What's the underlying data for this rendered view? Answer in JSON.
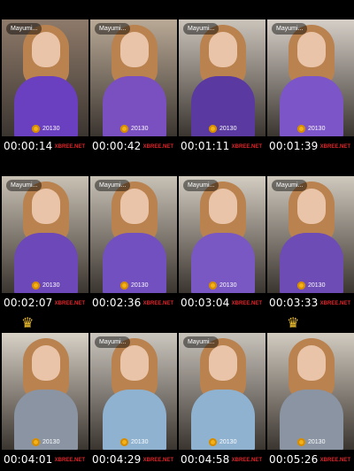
{
  "contact_sheet": {
    "watermark": "XBREE.NET",
    "thumbnails": [
      {
        "username": "Mayumi...",
        "coins": "20130",
        "timestamp": "00:00:14",
        "crown": false,
        "wall": "#8e7a6a",
        "outfit": "#6a3fc0"
      },
      {
        "username": "Mayumi...",
        "coins": "20130",
        "timestamp": "00:00:42",
        "crown": false,
        "wall": "#b9a996",
        "outfit": "#7a4fc0"
      },
      {
        "username": "Mayumi...",
        "coins": "20130",
        "timestamp": "00:01:11",
        "crown": false,
        "wall": "#cbc4bb",
        "outfit": "#5a3aa0"
      },
      {
        "username": "Mayumi...",
        "coins": "20130",
        "timestamp": "00:01:39",
        "crown": false,
        "wall": "#d6cfc8",
        "outfit": "#7c55c8"
      },
      {
        "username": "Mayumi...",
        "coins": "20130",
        "timestamp": "00:02:07",
        "crown": false,
        "wall": "#c9c1b4",
        "outfit": "#6c48b8"
      },
      {
        "username": "Mayumi...",
        "coins": "20130",
        "timestamp": "00:02:36",
        "crown": false,
        "wall": "#c8c1b6",
        "outfit": "#7250c0"
      },
      {
        "username": "Mayumi...",
        "coins": "20130",
        "timestamp": "00:03:04",
        "crown": false,
        "wall": "#d3ccc1",
        "outfit": "#7a58c4"
      },
      {
        "username": "Mayumi...",
        "coins": "20130",
        "timestamp": "00:03:33",
        "crown": false,
        "wall": "#cfc8bd",
        "outfit": "#6e4cb6"
      },
      {
        "username": "",
        "coins": "20130",
        "timestamp": "00:04:01",
        "crown": true,
        "wall": "#d8d1c6",
        "outfit": "#8a94a3"
      },
      {
        "username": "Mayumi...",
        "coins": "20130",
        "timestamp": "00:04:29",
        "crown": false,
        "wall": "#cbc6be",
        "outfit": "#8fb2d0"
      },
      {
        "username": "Mayumi...",
        "coins": "20130",
        "timestamp": "00:04:58",
        "crown": false,
        "wall": "#c7c2ba",
        "outfit": "#8fb2d0"
      },
      {
        "username": "",
        "coins": "20130",
        "timestamp": "00:05:26",
        "crown": true,
        "wall": "#d2cbc0",
        "outfit": "#8a94a3"
      }
    ]
  }
}
